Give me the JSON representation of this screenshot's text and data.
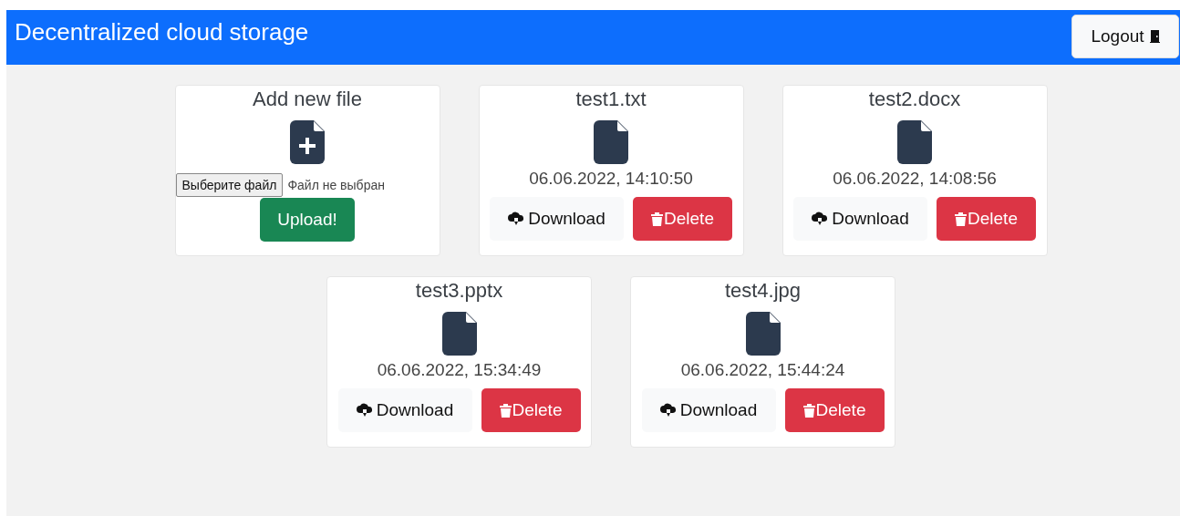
{
  "header": {
    "title": "Decentralized cloud storage",
    "logout": "Logout"
  },
  "upload_card": {
    "title": "Add new file",
    "file_input": {
      "button": "Выберите файл",
      "status": "Файл не выбран"
    },
    "upload_button": "Upload!"
  },
  "files": [
    {
      "name": "test1.txt",
      "date": "06.06.2022, 14:10:50",
      "download": "Download",
      "delete": "Delete"
    },
    {
      "name": "test2.docx",
      "date": "06.06.2022, 14:08:56",
      "download": "Download",
      "delete": "Delete"
    },
    {
      "name": "test3.pptx",
      "date": "06.06.2022, 15:34:49",
      "download": "Download",
      "delete": "Delete"
    },
    {
      "name": "test4.jpg",
      "date": "06.06.2022, 15:44:24",
      "download": "Download",
      "delete": "Delete"
    }
  ]
}
